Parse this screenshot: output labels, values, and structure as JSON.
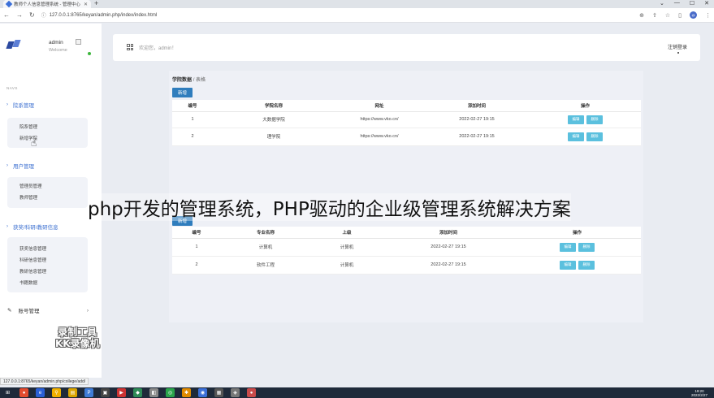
{
  "browser": {
    "tab_title": "教师个人信息管理系统 - 管理中心",
    "url": "127.0.0.1:8765/keyan/admin.php/index/index.html",
    "profile_initial": "@"
  },
  "sidebar": {
    "admin_name": "admin",
    "welcome": "Welcome",
    "nav_header": "NAVS",
    "groups": [
      {
        "title": "院系管理",
        "items": [
          "院系管理",
          "新增学院"
        ]
      },
      {
        "title": "用户管理",
        "items": [
          "管理员管理",
          "教师管理"
        ]
      },
      {
        "title": "获奖/科研/教研信息",
        "items": [
          "获奖信息管理",
          "科研信息管理",
          "教研信息管理",
          "书籍数据"
        ]
      }
    ],
    "account": "账号管理"
  },
  "header": {
    "welcome": "欢迎您，admin！",
    "logout": "注销登录"
  },
  "main": {
    "breadcrumb_main": "学院数据",
    "breadcrumb_sep": "/",
    "breadcrumb_sub": "表格",
    "add_label": "新增",
    "college_table": {
      "headers": [
        "编号",
        "学院名称",
        "网址",
        "添加时间",
        "操作"
      ],
      "rows": [
        [
          "1",
          "大数据学院",
          "https://www.vko.cn/",
          "2022-02-27 19:15"
        ],
        [
          "2",
          "理学院",
          "https://www.vko.cn/",
          "2022-02-27 19:15"
        ]
      ]
    },
    "major_table": {
      "headers": [
        "编号",
        "专业名称",
        "上级",
        "添加时间",
        "操作"
      ],
      "rows": [
        [
          "1",
          "计算机",
          "计算机",
          "2022-02-27 19:15"
        ],
        [
          "2",
          "软件工程",
          "计算机",
          "2022-02-27 19:15"
        ]
      ]
    },
    "edit_label": "编辑",
    "delete_label": "删除"
  },
  "overlay": {
    "caption": "php开发的管理系统，PHP驱动的企业级管理系统解决方案",
    "watermark_line1": "录制工具",
    "watermark_line2": "KK录像机"
  },
  "status_url": "127.0.0.1:8765/keyan/admin.php/college/add/",
  "taskbar": {
    "time": "19:20",
    "date": "2022/2/27"
  },
  "colors": {
    "accent": "#3b6fd0",
    "add_button": "#2f7dbd",
    "op_button": "#5bc0de"
  }
}
